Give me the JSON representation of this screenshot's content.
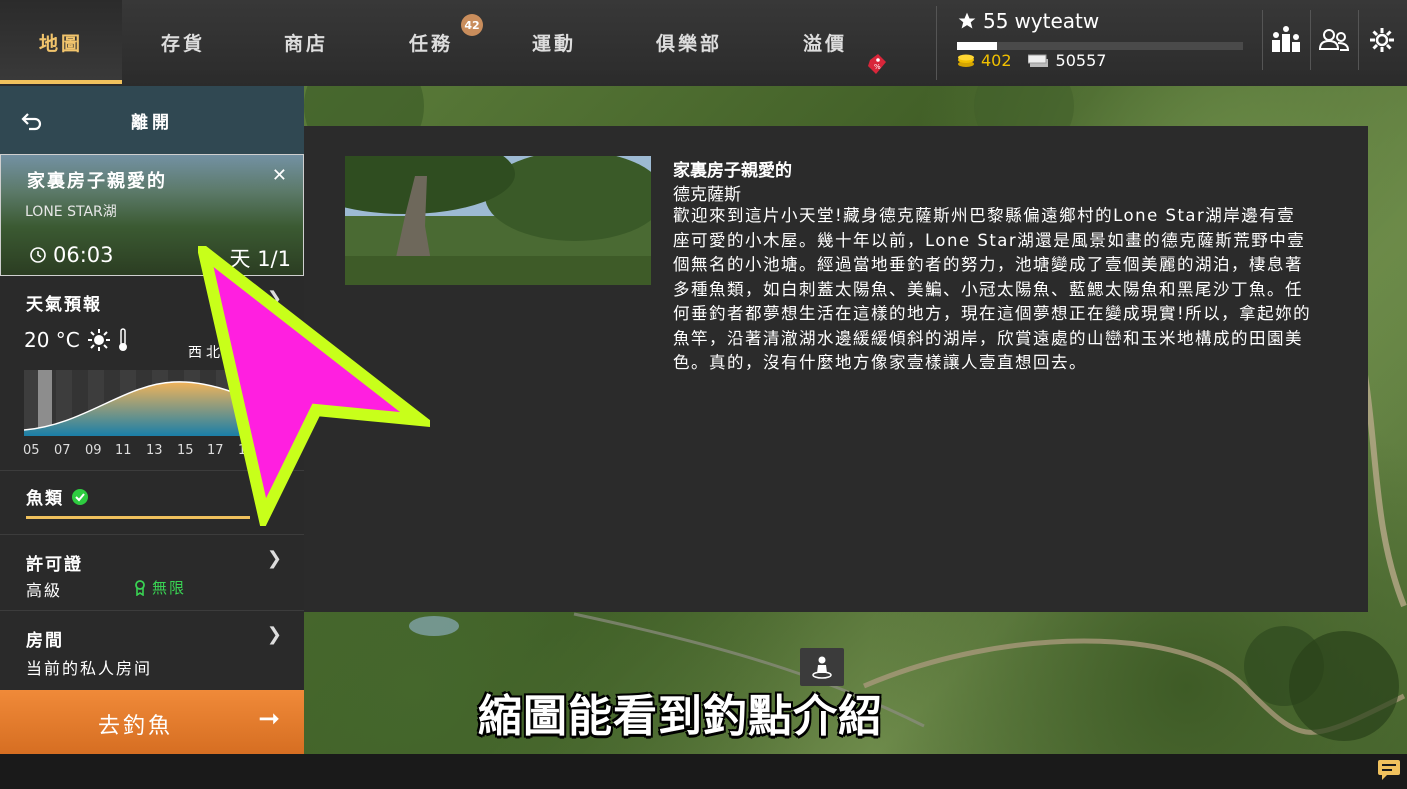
{
  "tabs": [
    {
      "label": "地圖",
      "active": true
    },
    {
      "label": "存貨"
    },
    {
      "label": "商店"
    },
    {
      "label": "任務",
      "badge": "42"
    },
    {
      "label": "運動"
    },
    {
      "label": "俱樂部"
    },
    {
      "label": "溢價",
      "sale_icon": "price-tag-icon"
    }
  ],
  "player": {
    "level": "55",
    "name": "wyteatw",
    "xp_progress": 0.14,
    "gold": "402",
    "silver": "50557"
  },
  "header_icons": [
    "leaderboard-icon",
    "friends-icon",
    "settings-icon"
  ],
  "sidebar": {
    "exit_label": "離開",
    "location": {
      "name": "家裏房子親愛的",
      "lake": "LONE STAR湖",
      "time": "06:03",
      "day": "天 1/1"
    },
    "weather": {
      "title": "天氣預報",
      "temperature": "20 °C",
      "wind": "西北",
      "hours": [
        "05",
        "07",
        "09",
        "11",
        "13",
        "15",
        "17",
        "19"
      ]
    },
    "fish": {
      "title": "魚類"
    },
    "license": {
      "title": "許可證",
      "level": "高級",
      "status": "無限"
    },
    "room": {
      "title": "房間",
      "value": "当前的私人房间"
    },
    "go_fishing": "去釣魚"
  },
  "info": {
    "title": "家裏房子親愛的",
    "region": "德克薩斯",
    "description": "歡迎來到這片小天堂!藏身德克薩斯州巴黎縣偏遠鄉村的Lone Star湖岸邊有壹座可愛的小木屋。幾十年以前，Lone Star湖還是風景如畫的德克薩斯荒野中壹個無名的小池塘。經過當地垂釣者的努力，池塘變成了壹個美麗的湖泊，棲息著多種魚類，如白刺蓋太陽魚、美鯿、小冠太陽魚、藍鰓太陽魚和黑尾沙丁魚。任何垂釣者都夢想生活在這樣的地方，現在這個夢想正在變成現實!所以，拿起妳的魚竿，沿著清澈湖水邊緩緩傾斜的湖岸，欣賞遠處的山巒和玉米地構成的田園美色。真的，沒有什麼地方像家壹樣讓人壹直想回去。"
  },
  "caption": "縮圖能看到釣點介紹",
  "colors": {
    "accent": "#f0c15d",
    "go_button": "#e87d2f",
    "pointer_fill": "#ff1fe0",
    "pointer_outline": "#c8ff1a"
  }
}
